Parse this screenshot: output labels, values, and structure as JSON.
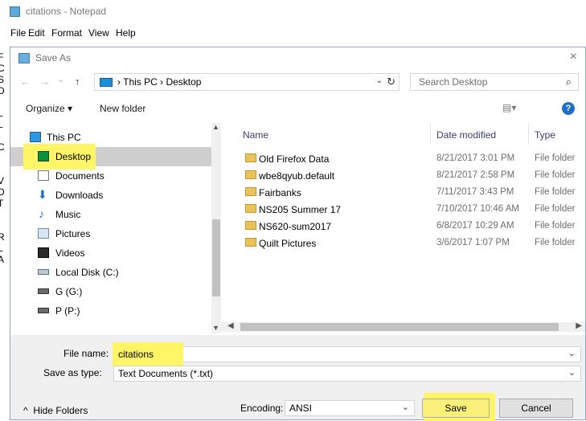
{
  "notepad": {
    "title": "citations - Notepad",
    "menu": [
      "File",
      "Edit",
      "Format",
      "View",
      "Help"
    ],
    "edge_chars": [
      "F",
      "C",
      "S",
      "D",
      "L",
      "L",
      "I",
      "C",
      "I",
      "V",
      "D",
      "T",
      "R",
      "L",
      "A"
    ]
  },
  "dialog": {
    "title": "Save As",
    "close": "×",
    "nav": {
      "back": "←",
      "forward": "→",
      "recent": "⌄",
      "up": "↑"
    },
    "breadcrumb": "› This PC › Desktop",
    "address_dropdown": "⌄",
    "refresh": "↻",
    "search_placeholder": "Search Desktop",
    "search_icon": "⌕",
    "toolbar": {
      "organize": "Organize ▾",
      "new_folder": "New folder",
      "view": "▤▾",
      "help": "?"
    },
    "nav_pane": [
      {
        "label": "This PC",
        "icon": "monitor-icon"
      },
      {
        "label": "Desktop",
        "icon": "desktop-icon",
        "selected": true
      },
      {
        "label": "Documents",
        "icon": "documents-icon"
      },
      {
        "label": "Downloads",
        "icon": "downloads-icon"
      },
      {
        "label": "Music",
        "icon": "music-icon"
      },
      {
        "label": "Pictures",
        "icon": "pictures-icon"
      },
      {
        "label": "Videos",
        "icon": "videos-icon"
      },
      {
        "label": "Local Disk (C:)",
        "icon": "drive-icon"
      },
      {
        "label": "G (G:)",
        "icon": "network-drive-icon"
      },
      {
        "label": "P (P:)",
        "icon": "network-drive-icon"
      }
    ],
    "columns": {
      "name": "Name",
      "date": "Date modified",
      "type": "Type"
    },
    "files": [
      {
        "name": "Old Firefox Data",
        "date": "8/21/2017 3:01 PM",
        "type": "File folder"
      },
      {
        "name": "wbe8qyub.default",
        "date": "8/21/2017 2:58 PM",
        "type": "File folder"
      },
      {
        "name": "Fairbanks",
        "date": "7/11/2017 3:43 PM",
        "type": "File folder"
      },
      {
        "name": "NS205 Summer 17",
        "date": "7/10/2017 10:46 AM",
        "type": "File folder"
      },
      {
        "name": "NS620-sum2017",
        "date": "6/8/2017 10:29 AM",
        "type": "File folder"
      },
      {
        "name": "Quilt Pictures",
        "date": "3/6/2017 1:07 PM",
        "type": "File folder"
      }
    ],
    "file_name_label": "File name:",
    "file_name_value": "citations",
    "save_type_label": "Save as type:",
    "save_type_value": "Text Documents (*.txt)",
    "hide_folders": "Hide Folders",
    "encoding_label": "Encoding:",
    "encoding_value": "ANSI",
    "save": "Save",
    "cancel": "Cancel",
    "highlight_color": "#fff566"
  }
}
